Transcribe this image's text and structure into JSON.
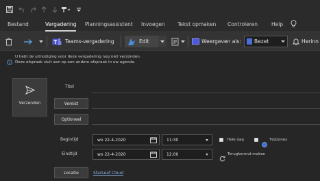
{
  "tabs": {
    "items": [
      "Bestand",
      "Vergadering",
      "Planningsassistent",
      "Invoegen",
      "Tekst opmaken",
      "Controleren",
      "Help"
    ],
    "active": "Vergadering"
  },
  "ribbon": {
    "teams_label": "Teams-vergadering",
    "edit_label": "Edit",
    "show_as_label": "Weergeven als:",
    "show_as_value": "Bezet",
    "reminder_label": "Herinn"
  },
  "info": {
    "line1": "U hebt de uitnodiging voor deze vergadering nog niet verzonden.",
    "line2": "Deze afspraak sluit aan op een andere afspraak in uw agenda."
  },
  "form": {
    "send_label": "Verzenden",
    "title_label": "Titel",
    "required_label": "Vereist",
    "optional_label": "Optioneel",
    "start_label": "Begintijd",
    "end_label": "Eindtijd",
    "start_date": "wo 22-4-2020",
    "start_time": "11:30",
    "end_date": "wo 22-4-2020",
    "end_time": "12:00",
    "all_day_label": "Hele dag",
    "timezones_label": "Tijdzones",
    "recurring_label": "Terugkerend maken",
    "location_label": "Locatie",
    "location_value": "StarLeaf Cloud"
  }
}
